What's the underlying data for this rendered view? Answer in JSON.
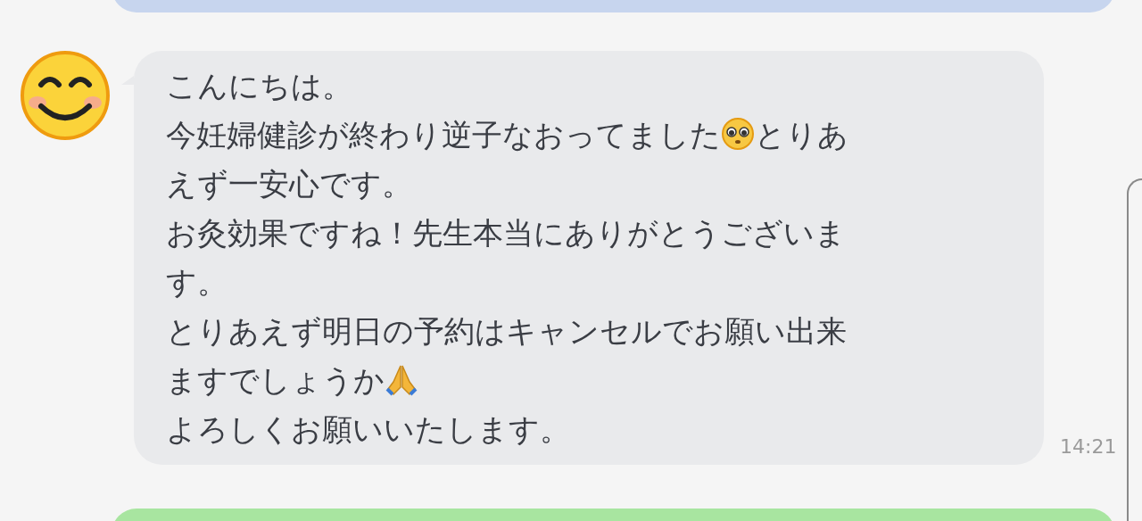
{
  "message": {
    "parts": [
      {
        "kind": "text",
        "text": "こんにちは。"
      },
      {
        "kind": "break"
      },
      {
        "kind": "text",
        "text": "今妊婦健診が終わり逆子なおってました"
      },
      {
        "kind": "pleading"
      },
      {
        "kind": "text",
        "text": "とりあ"
      },
      {
        "kind": "break"
      },
      {
        "kind": "text",
        "text": "えず一安心です。"
      },
      {
        "kind": "break"
      },
      {
        "kind": "text",
        "text": "お灸効果ですね！先生本当にありがとうございま"
      },
      {
        "kind": "break"
      },
      {
        "kind": "text",
        "text": "す。"
      },
      {
        "kind": "break"
      },
      {
        "kind": "text",
        "text": "とりあえず明日の予約はキャンセルでお願い出来"
      },
      {
        "kind": "break"
      },
      {
        "kind": "text",
        "text": "ますでしょうか"
      },
      {
        "kind": "praying"
      },
      {
        "kind": "break"
      },
      {
        "kind": "text",
        "text": "よろしくお願いいたします。"
      }
    ],
    "time": "14:21"
  }
}
